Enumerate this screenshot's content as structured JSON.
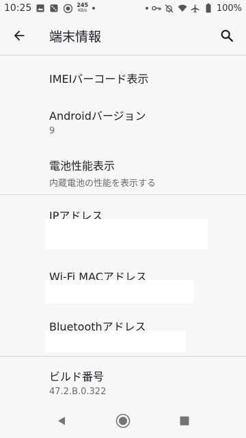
{
  "status_bar": {
    "time": "10:25",
    "net_speed_value": "245",
    "net_speed_unit": "KB/s",
    "battery": "100%",
    "left_icons": [
      "image-icon",
      "dice-icon",
      "target-icon"
    ],
    "right_icons": [
      "dot-icon",
      "key-icon",
      "bell-off-icon",
      "wifi-icon",
      "airplane-icon",
      "battery-icon"
    ]
  },
  "app_bar": {
    "title": "端末情報",
    "back_icon": "arrow-left-icon",
    "search_icon": "search-icon"
  },
  "items": [
    {
      "title": "IMEIバーコード表示",
      "subtitle": ""
    },
    {
      "title": "Androidバージョン",
      "subtitle": "9"
    },
    {
      "title": "電池性能表示",
      "subtitle": "内蔵電池の性能を表示する"
    },
    {
      "title": "IPアドレス",
      "subtitle": ""
    },
    {
      "title": "Wi-Fi MACアドレス",
      "subtitle": ""
    },
    {
      "title": "Bluetoothアドレス",
      "subtitle": ""
    },
    {
      "title": "ビルド番号",
      "subtitle": "47.2.B.0.322"
    }
  ],
  "nav_bar": {
    "back_icon": "triangle-back-icon",
    "home_icon": "circle-home-icon",
    "recents_icon": "square-recents-icon"
  },
  "colors": {
    "background": "#f7f7f7",
    "text_primary": "#202124",
    "text_secondary": "#6b6b6b",
    "divider": "#d6d6d6"
  }
}
